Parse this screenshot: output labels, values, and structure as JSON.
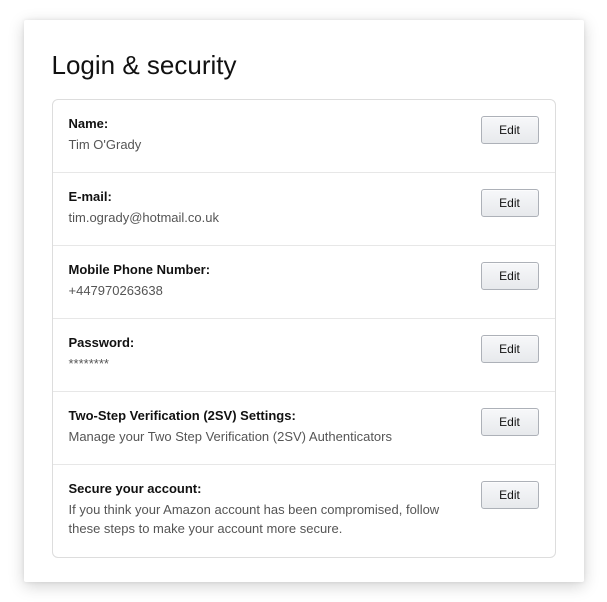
{
  "title": "Login & security",
  "rows": [
    {
      "label": "Name:",
      "value": "Tim O'Grady",
      "button": "Edit"
    },
    {
      "label": "E-mail:",
      "value": "tim.ogrady@hotmail.co.uk",
      "button": "Edit"
    },
    {
      "label": "Mobile Phone Number:",
      "value": "+447970263638",
      "button": "Edit"
    },
    {
      "label": "Password:",
      "value": "********",
      "button": "Edit"
    },
    {
      "label": "Two-Step Verification (2SV) Settings:",
      "value": "Manage your Two Step Verification (2SV) Authenticators",
      "button": "Edit"
    },
    {
      "label": "Secure your account:",
      "value": "If you think your Amazon account has been compromised, follow these steps to make your account more secure.",
      "button": "Edit"
    }
  ]
}
